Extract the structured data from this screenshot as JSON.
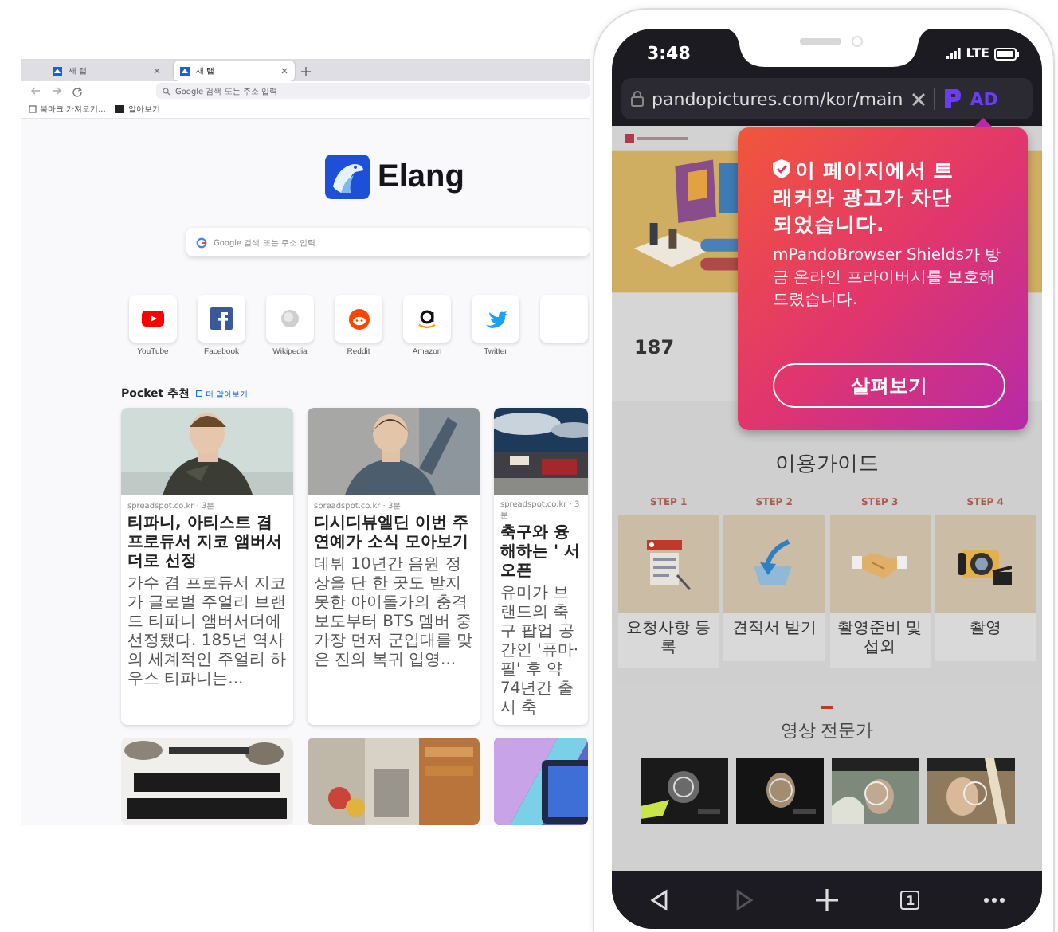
{
  "browser": {
    "tabs": [
      {
        "label": "새 탭",
        "selected": false
      },
      {
        "label": "새 탭",
        "selected": true
      }
    ],
    "address_bar": {
      "placeholder": "Google 검색 또는 주소 입력"
    },
    "bookmarks": [
      "북마크 가져오기...",
      "알아보기"
    ],
    "logo_text": "Elang",
    "search": {
      "placeholder": "Google 검색 또는 주소 입력"
    },
    "shortcuts": [
      {
        "kind": "youtube",
        "label": "YouTube"
      },
      {
        "kind": "facebook",
        "label": "Facebook"
      },
      {
        "kind": "wikipedia",
        "label": "Wikipedia"
      },
      {
        "kind": "reddit",
        "label": "Reddit"
      },
      {
        "kind": "amazon",
        "label": "Amazon"
      },
      {
        "kind": "twitter",
        "label": "Twitter"
      },
      {
        "kind": "blank"
      }
    ],
    "pocket": {
      "title": "Pocket 추천",
      "link": "더 알아보기",
      "cards": [
        {
          "kind": "article",
          "source": "spreadspot.co.kr · 3분",
          "title": "티파니, 아티스트 겸 프로듀서 지코 앰버서더로 선정",
          "excerpt": "가수 겸 프로듀서 지코가 글로벌 주얼리 브랜드 티파니 앰버서더에 선정됐다. 185년 역사의 세계적인 주얼리 하우스 티파니는..."
        },
        {
          "kind": "article",
          "source": "spreadspot.co.kr · 3분",
          "title": "디시디뷰엘딘 이번 주 연예가 소식 모아보기",
          "excerpt": "데뷔 10년간 음원 정상을 단 한 곳도 받지 못한 아이돌가의 충격 보도부터 BTS 멤버 중 가장 먼저 군입대를 맞은 진의 복귀 입영..."
        },
        {
          "kind": "article",
          "source": "spreadspot.co.kr · 3분",
          "title": "축구와 융해하는 ' 서 오픈",
          "excerpt": "유미가 브랜드의 축구 팝업 공간인 '퓨마·필' 후 약 74년간 출시 축"
        },
        {
          "kind": "picture"
        },
        {
          "kind": "picture"
        },
        {
          "kind": "picture"
        }
      ]
    }
  },
  "phone": {
    "time": "3:48",
    "network": "LTE",
    "url": "pandopictures.com/kor/main",
    "ad_badge": "AD",
    "page": {
      "stat_value": "187",
      "guide_title": "이용가이드",
      "steps": [
        {
          "kind": "document",
          "label": "STEP 1",
          "title": "요청사항 등록"
        },
        {
          "kind": "download",
          "label": "STEP 2",
          "title": "견적서 받기"
        },
        {
          "kind": "handshake",
          "label": "STEP 3",
          "title": "촬영준비 및 섭외"
        },
        {
          "kind": "camera",
          "label": "STEP 4",
          "title": "촬영"
        }
      ],
      "video_title": "영상 전문가",
      "videos": [
        {
          "kind": "picture"
        },
        {
          "kind": "picture"
        },
        {
          "kind": "picture"
        },
        {
          "kind": "picture"
        }
      ]
    },
    "shield_popup": {
      "headline": "이 페이지에서 트래커와 광고가 차단되었습니다.",
      "message": "mPandoBrowser Shields가 방금 온라인 프라이버시를 보호해드렸습니다.",
      "button": "살펴보기"
    },
    "toolbar": {
      "back_disabled": false,
      "forward_disabled": true,
      "tab_count": "1"
    }
  }
}
